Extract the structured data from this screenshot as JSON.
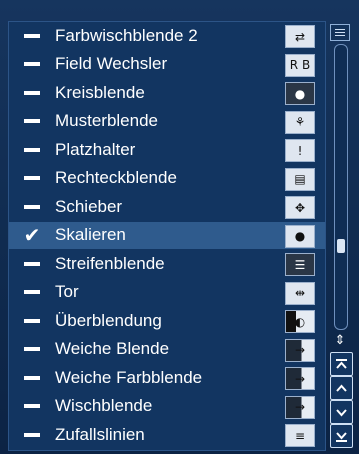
{
  "list": {
    "items": [
      {
        "label": "Farbwischblende 2",
        "state": "dash",
        "thumb": "⇄",
        "selected": false
      },
      {
        "label": "Field Wechsler",
        "state": "dash",
        "thumb": "R B",
        "selected": false
      },
      {
        "label": "Kreisblende",
        "state": "dash",
        "thumb": "●",
        "selected": false
      },
      {
        "label": "Musterblende",
        "state": "dash",
        "thumb": "⚘",
        "selected": false
      },
      {
        "label": "Platzhalter",
        "state": "dash",
        "thumb": "!",
        "selected": false
      },
      {
        "label": "Rechteckblende",
        "state": "dash",
        "thumb": "▤",
        "selected": false
      },
      {
        "label": "Schieber",
        "state": "dash",
        "thumb": "✥",
        "selected": false
      },
      {
        "label": "Skalieren",
        "state": "check",
        "thumb": "●",
        "selected": true
      },
      {
        "label": "Streifenblende",
        "state": "dash",
        "thumb": "☰",
        "selected": false
      },
      {
        "label": "Tor",
        "state": "dash",
        "thumb": "⇹",
        "selected": false
      },
      {
        "label": "Überblendung",
        "state": "dash",
        "thumb": "◐",
        "selected": false
      },
      {
        "label": "Weiche Blende",
        "state": "dash",
        "thumb": "→",
        "selected": false
      },
      {
        "label": "Weiche Farbblende",
        "state": "dash",
        "thumb": "→",
        "selected": false
      },
      {
        "label": "Wischblende",
        "state": "dash",
        "thumb": "→",
        "selected": false
      },
      {
        "label": "Zufallslinien",
        "state": "dash",
        "thumb": "≡",
        "selected": false
      }
    ],
    "check_glyph": "✔"
  },
  "scrollbar": {
    "updown_glyph": "⇕",
    "thumb_position": 0.72
  },
  "colors": {
    "background": "#123561",
    "selected_row": "#2f5b8d",
    "text": "#ffffff"
  }
}
